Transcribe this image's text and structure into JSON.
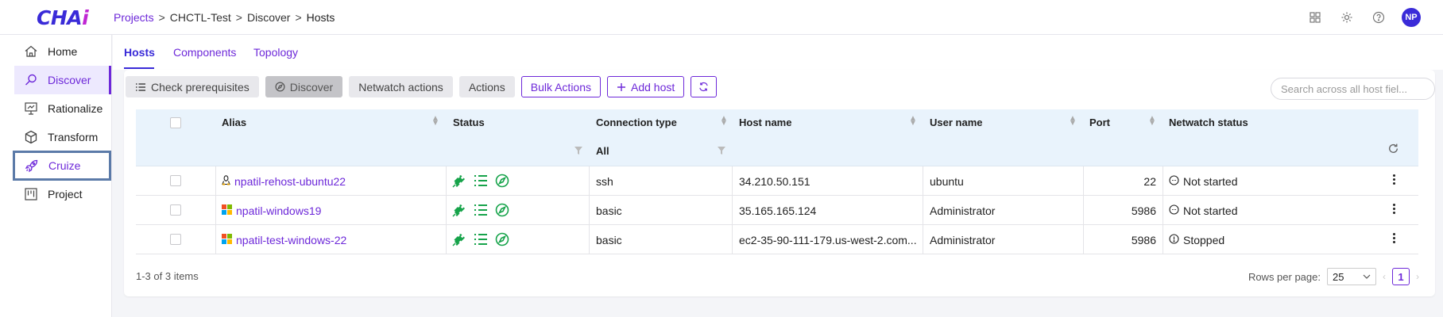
{
  "app": {
    "logo": "CHAi"
  },
  "breadcrumb": {
    "projects": "Projects",
    "project": "CHCTL-Test",
    "discover": "Discover",
    "current": "Hosts",
    "sep": ">"
  },
  "user": {
    "initials": "NP"
  },
  "sidebar": {
    "items": [
      {
        "label": "Home",
        "icon": "home-icon"
      },
      {
        "label": "Discover",
        "icon": "discover-icon"
      },
      {
        "label": "Rationalize",
        "icon": "rationalize-icon"
      },
      {
        "label": "Transform",
        "icon": "cube-icon"
      },
      {
        "label": "Cruize",
        "icon": "rocket-icon"
      },
      {
        "label": "Project",
        "icon": "project-icon"
      }
    ]
  },
  "tabs": [
    {
      "label": "Hosts"
    },
    {
      "label": "Components"
    },
    {
      "label": "Topology"
    }
  ],
  "toolbar": {
    "check_prereq": "Check prerequisites",
    "discover": "Discover",
    "netwatch_actions": "Netwatch actions",
    "actions": "Actions",
    "bulk_actions": "Bulk Actions",
    "add_host": "Add host"
  },
  "search": {
    "placeholder": "Search across all host fiel..."
  },
  "table": {
    "columns": {
      "alias": "Alias",
      "status": "Status",
      "connection_type": "Connection type",
      "host_name": "Host name",
      "user_name": "User name",
      "port": "Port",
      "netwatch_status": "Netwatch status"
    },
    "connection_filter": "All",
    "rows": [
      {
        "os": "linux",
        "alias": "npatil-rehost-ubuntu22",
        "connection": "ssh",
        "host": "34.210.50.151",
        "user": "ubuntu",
        "port": "22",
        "netwatch": "Not started"
      },
      {
        "os": "windows",
        "alias": "npatil-windows19",
        "connection": "basic",
        "host": "35.165.165.124",
        "user": "Administrator",
        "port": "5986",
        "netwatch": "Not started"
      },
      {
        "os": "windows",
        "alias": "npatil-test-windows-22",
        "connection": "basic",
        "host": "ec2-35-90-111-179.us-west-2.com...",
        "user": "Administrator",
        "port": "5986",
        "netwatch": "Stopped"
      }
    ]
  },
  "footer": {
    "count": "1-3 of 3 items",
    "rows_per_page_label": "Rows per page:",
    "rows_per_page": "25",
    "page": "1"
  },
  "colors": {
    "accent": "#6d28d9",
    "brand": "#3a2bd8",
    "status_green": "#16a34a",
    "header_bg": "#e9f3fc"
  }
}
